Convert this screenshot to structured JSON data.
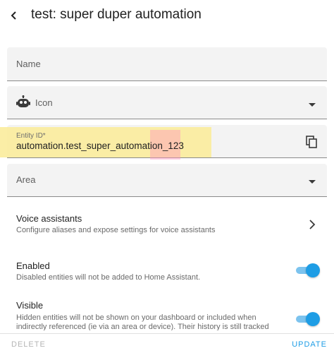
{
  "header": {
    "title": "test: super duper automation",
    "back_icon": "arrow-left-icon"
  },
  "form": {
    "name": {
      "label": "Name",
      "value": ""
    },
    "icon": {
      "label": "Icon",
      "icon": "robot-icon"
    },
    "entity_id": {
      "label": "Entity ID*",
      "value": "automation.test_super_automation_123",
      "copy_icon": "copy-icon"
    },
    "area": {
      "label": "Area",
      "value": ""
    }
  },
  "voice_assistants": {
    "title": "Voice assistants",
    "description": "Configure aliases and expose settings for voice assistants"
  },
  "enabled": {
    "title": "Enabled",
    "description": "Disabled entities will not be added to Home Assistant.",
    "checked": true
  },
  "visible": {
    "title": "Visible",
    "description": "Hidden entities will not be shown on your dashboard or included when indirectly referenced (ie via an area or device). Their history is still tracked",
    "checked": true
  },
  "footer": {
    "delete_label": "DELETE",
    "update_label": "UPDATE"
  },
  "colors": {
    "accent": "#1e9de5",
    "highlight_yellow": "#faeb96",
    "highlight_pink": "#ff96be"
  }
}
